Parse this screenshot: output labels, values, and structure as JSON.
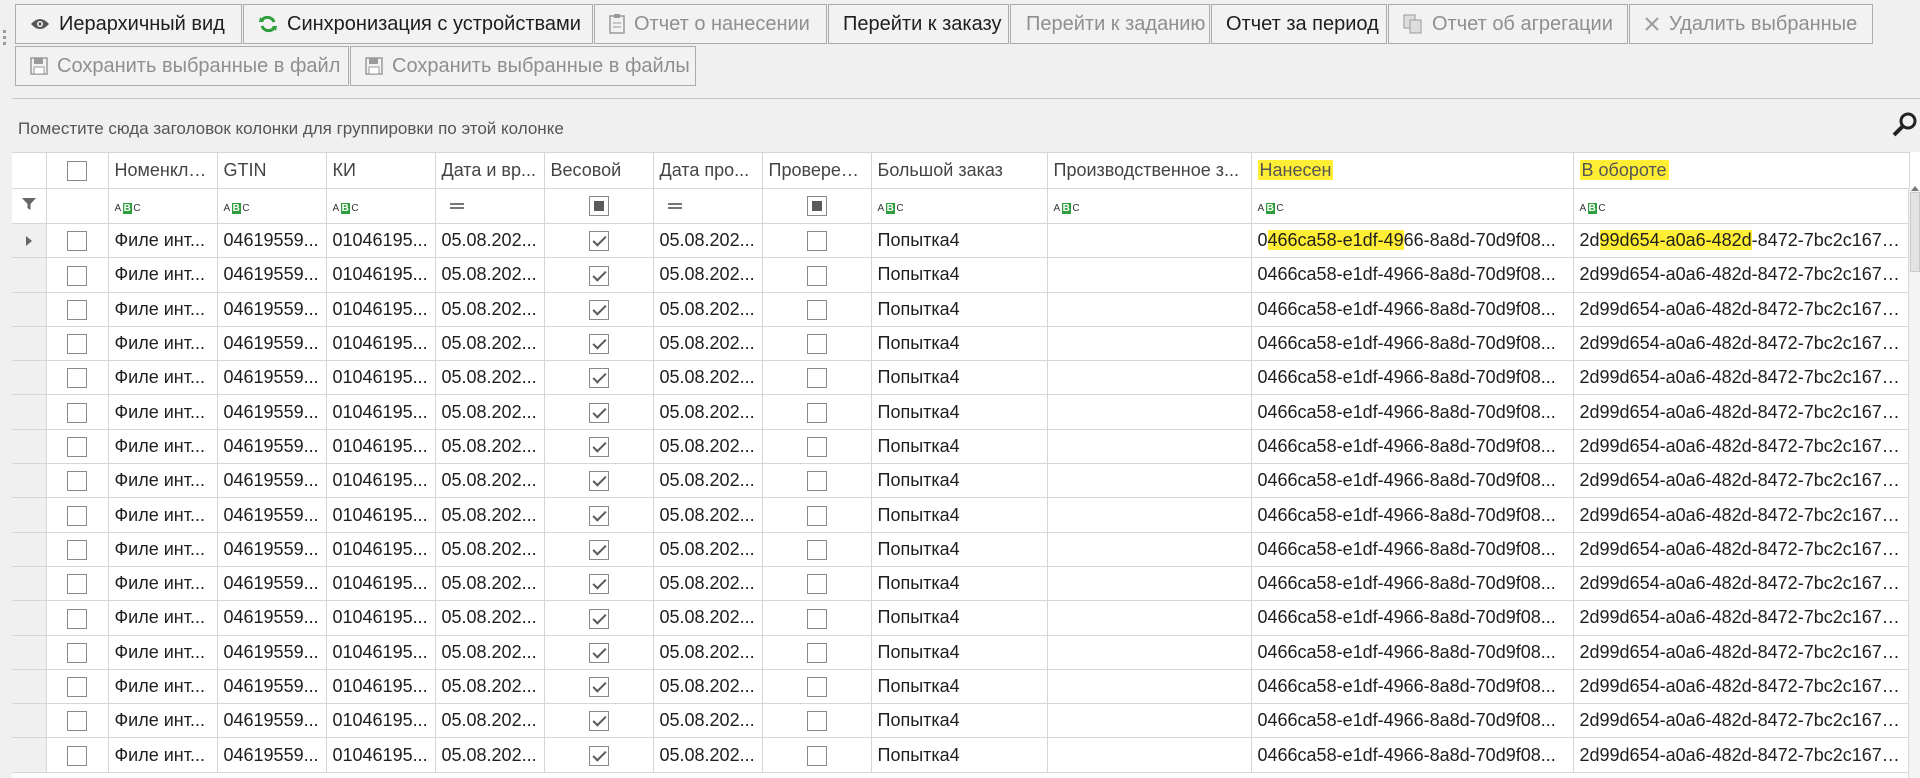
{
  "toolbar": {
    "row1": [
      {
        "label": "Иерархичный вид",
        "icon": "eye-icon",
        "disabled": false
      },
      {
        "label": "Синхронизация с устройствами",
        "icon": "sync-icon",
        "disabled": false
      },
      {
        "label": "Отчет о нанесении",
        "icon": "clipboard-icon",
        "disabled": true
      },
      {
        "label": "Перейти к заказу",
        "icon": "",
        "disabled": false
      },
      {
        "label": "Перейти к заданию",
        "icon": "",
        "disabled": true
      },
      {
        "label": "Отчет за период",
        "icon": "",
        "disabled": false
      },
      {
        "label": "Отчет об агрегации",
        "icon": "copy-icon",
        "disabled": true
      },
      {
        "label": "Удалить выбранные",
        "icon": "close-icon",
        "disabled": true
      }
    ],
    "row2": [
      {
        "label": "Сохранить выбранные в файл",
        "icon": "save-icon",
        "disabled": true
      },
      {
        "label": "Сохранить выбранные в файлы",
        "icon": "save-icon",
        "disabled": true
      }
    ]
  },
  "group_panel": {
    "text": "Поместите сюда заголовок колонки для группировки по этой колонке"
  },
  "grid": {
    "columns": [
      "Номенкла...",
      "GTIN",
      "КИ",
      "Дата и вр...",
      "Весовой",
      "Дата про...",
      "Проверен...",
      "Большой заказ",
      "Производственное з...",
      "Нанесен",
      "В обороте"
    ],
    "row_values": {
      "nomenclature": "Филе инт...",
      "gtin": "04619559...",
      "ki": "01046195...",
      "date_time": "05.08.202...",
      "weighted": true,
      "date_prod": "05.08.202...",
      "checked": false,
      "big_order": "Попытка4",
      "prod_task": "",
      "applied": "0466ca58-e1df-4966-8a8d-70d9f08...",
      "in_circulation": "2d99d654-a0a6-482d-8472-7bc2c1672..."
    },
    "first_row_highlight": {
      "applied": [
        "0",
        "466ca58-e1df-49",
        "66-8a8d-70d9f08..."
      ],
      "in_circulation": [
        "2d",
        "99d654-a0a6-482d",
        "-8472-7bc2c1672..."
      ]
    },
    "row_count": 16
  },
  "colors": {
    "highlight": "#ffee33",
    "sync_icon": "#2e9e3e"
  }
}
